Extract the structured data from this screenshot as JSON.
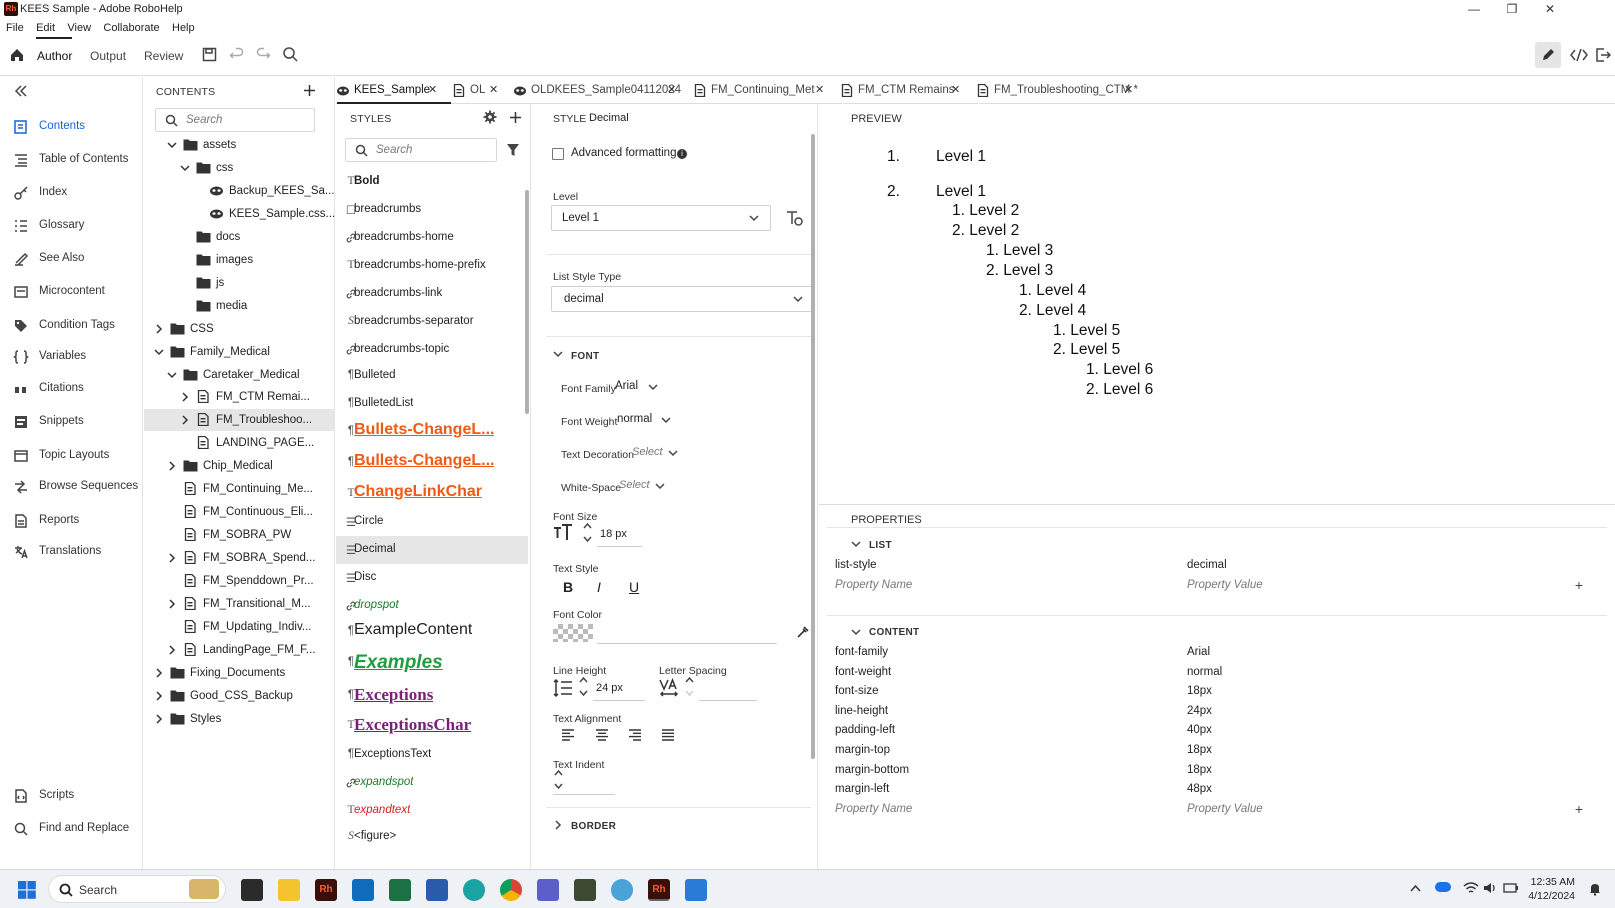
{
  "window": {
    "app_badge": "Rh",
    "title": "KEES Sample - Adobe RoboHelp",
    "minimize": "—",
    "maximize": "❐",
    "close": "✕"
  },
  "menu": [
    "File",
    "Edit",
    "View",
    "Collaborate",
    "Help"
  ],
  "toolbar": {
    "modes": [
      "Author",
      "Output",
      "Review"
    ],
    "active_mode": "Author"
  },
  "leftnav": {
    "items": [
      {
        "label": "Contents",
        "icon": "contents-icon"
      },
      {
        "label": "Table of Contents",
        "icon": "toc-icon"
      },
      {
        "label": "Index",
        "icon": "index-icon"
      },
      {
        "label": "Glossary",
        "icon": "glossary-icon"
      },
      {
        "label": "See Also",
        "icon": "see-also-icon"
      },
      {
        "label": "Microcontent",
        "icon": "microcontent-icon"
      },
      {
        "label": "Condition Tags",
        "icon": "tag-icon"
      },
      {
        "label": "Variables",
        "icon": "braces-icon"
      },
      {
        "label": "Citations",
        "icon": "quote-icon"
      },
      {
        "label": "Snippets",
        "icon": "snippet-icon"
      },
      {
        "label": "Topic Layouts",
        "icon": "layout-icon"
      },
      {
        "label": "Browse Sequences",
        "icon": "sequence-icon"
      },
      {
        "label": "Reports",
        "icon": "report-icon"
      },
      {
        "label": "Translations",
        "icon": "translate-icon"
      },
      {
        "label": "Scripts",
        "icon": "script-icon"
      },
      {
        "label": "Find and Replace",
        "icon": "find-replace-icon"
      }
    ]
  },
  "contents": {
    "title": "CONTENTS",
    "search_placeholder": "Search",
    "tree": [
      {
        "label": "assets",
        "type": "folder",
        "expanded": true
      },
      {
        "label": "css",
        "type": "folder",
        "expanded": true
      },
      {
        "label": "Backup_KEES_Sa...",
        "type": "css"
      },
      {
        "label": "KEES_Sample.css...",
        "type": "css"
      },
      {
        "label": "docs",
        "type": "folder"
      },
      {
        "label": "images",
        "type": "folder"
      },
      {
        "label": "js",
        "type": "folder"
      },
      {
        "label": "media",
        "type": "folder"
      },
      {
        "label": "CSS",
        "type": "folder",
        "collapsed": true
      },
      {
        "label": "Family_Medical",
        "type": "folder",
        "expanded": true
      },
      {
        "label": "Caretaker_Medical",
        "type": "folder",
        "expanded": true
      },
      {
        "label": "FM_CTM Remai...",
        "type": "doc",
        "collapsed": true
      },
      {
        "label": "FM_Troubleshoo...",
        "type": "doc",
        "collapsed": true,
        "selected": true
      },
      {
        "label": "LANDING_PAGE...",
        "type": "doc"
      },
      {
        "label": "Chip_Medical",
        "type": "folder",
        "collapsed": true
      },
      {
        "label": "FM_Continuing_Me...",
        "type": "doc"
      },
      {
        "label": "FM_Continuous_Eli...",
        "type": "doc"
      },
      {
        "label": "FM_SOBRA_PW",
        "type": "doc"
      },
      {
        "label": "FM_SOBRA_Spend...",
        "type": "doc",
        "collapsed": true
      },
      {
        "label": "FM_Spenddown_Pr...",
        "type": "doc"
      },
      {
        "label": "FM_Transitional_M...",
        "type": "doc",
        "collapsed": true
      },
      {
        "label": "FM_Updating_Indiv...",
        "type": "doc"
      },
      {
        "label": "LandingPage_FM_F...",
        "type": "doc",
        "collapsed": true
      },
      {
        "label": "Fixing_Documents",
        "type": "folder",
        "collapsed": true
      },
      {
        "label": "Good_CSS_Backup",
        "type": "folder",
        "collapsed": true
      },
      {
        "label": "Styles",
        "type": "folder",
        "collapsed": true
      }
    ]
  },
  "tabs": [
    {
      "label": "KEES_Sample",
      "active": true
    },
    {
      "label": "OL"
    },
    {
      "label": "OLDKEES_Sample04112024"
    },
    {
      "label": "FM_Continuing_Met"
    },
    {
      "label": "FM_CTM Remains"
    },
    {
      "label": "FM_Troubleshooting_CTM *"
    }
  ],
  "styles_panel": {
    "title": "STYLES",
    "search_placeholder": "Search",
    "items": [
      {
        "label": "Bold",
        "icon": "T"
      },
      {
        "label": "breadcrumbs",
        "icon": "☐"
      },
      {
        "label": "breadcrumbs-home",
        "icon": "link"
      },
      {
        "label": "breadcrumbs-home-prefix",
        "icon": "T"
      },
      {
        "label": "breadcrumbs-link",
        "icon": "link"
      },
      {
        "label": "breadcrumbs-separator",
        "icon": "S"
      },
      {
        "label": "breadcrumbs-topic",
        "icon": "link"
      },
      {
        "label": "Bulleted",
        "icon": "¶"
      },
      {
        "label": "BulletedList",
        "icon": "¶"
      },
      {
        "label": "Bullets-ChangeL...",
        "icon": "¶"
      },
      {
        "label": "Bullets-ChangeL...",
        "icon": "¶"
      },
      {
        "label": "ChangeLinkChar",
        "icon": "T"
      },
      {
        "label": "Circle",
        "icon": "☰"
      },
      {
        "label": "Decimal",
        "icon": "☰",
        "selected": true
      },
      {
        "label": "Disc",
        "icon": "☰"
      },
      {
        "label": "dropspot",
        "icon": "link"
      },
      {
        "label": "ExampleContent",
        "icon": "¶"
      },
      {
        "label": "Examples",
        "icon": "¶"
      },
      {
        "label": "Exceptions",
        "icon": "¶"
      },
      {
        "label": "ExceptionsChar",
        "icon": "T"
      },
      {
        "label": "ExceptionsText",
        "icon": "¶"
      },
      {
        "label": "expandspot",
        "icon": "link"
      },
      {
        "label": "expandtext",
        "icon": "T"
      },
      {
        "label": "<figure>",
        "icon": "S"
      }
    ]
  },
  "editor": {
    "header_label": "STYLE",
    "style_name": "Decimal",
    "advanced_formatting": "Advanced formatting",
    "level_label": "Level",
    "level_value": "Level 1",
    "list_style_type_label": "List Style Type",
    "list_style_type_value": "decimal",
    "font_section": "FONT",
    "font_family_label": "Font Family",
    "font_family_value": "Arial",
    "font_weight_label": "Font Weight",
    "font_weight_value": "normal",
    "text_decoration_label": "Text Decoration",
    "text_decoration_value": "Select",
    "white_space_label": "White-Space",
    "white_space_value": "Select",
    "font_size_label": "Font Size",
    "font_size_value": "18 px",
    "text_style_label": "Text Style",
    "font_color_label": "Font Color",
    "line_height_label": "Line Height",
    "line_height_value": "24 px",
    "letter_spacing_label": "Letter Spacing",
    "text_alignment_label": "Text Alignment",
    "text_indent_label": "Text Indent",
    "border_section": "BORDER",
    "bold_glyph": "B",
    "italic_glyph": "I",
    "underline_glyph": "U"
  },
  "preview": {
    "title": "PREVIEW",
    "lines": [
      {
        "marker": "1.",
        "text": "Level 1"
      },
      {
        "marker": "2.",
        "text": "Level 1"
      },
      {
        "text": "1. Level 2"
      },
      {
        "text": "2. Level 2"
      },
      {
        "text": "1. Level 3"
      },
      {
        "text": "2. Level 3"
      },
      {
        "text": "1. Level 4"
      },
      {
        "text": "2. Level 4"
      },
      {
        "text": "1. Level 5"
      },
      {
        "text": "2. Level 5"
      },
      {
        "text": "1. Level 6"
      },
      {
        "text": "2. Level 6"
      }
    ]
  },
  "properties": {
    "title": "PROPERTIES",
    "list_section": "LIST",
    "list_rows": [
      {
        "name": "list-style",
        "value": "decimal"
      }
    ],
    "content_section": "CONTENT",
    "content_rows": [
      {
        "name": "font-family",
        "value": "Arial"
      },
      {
        "name": "font-weight",
        "value": "normal"
      },
      {
        "name": "font-size",
        "value": "18px"
      },
      {
        "name": "line-height",
        "value": "24px"
      },
      {
        "name": "padding-left",
        "value": "40px"
      },
      {
        "name": "margin-top",
        "value": "18px"
      },
      {
        "name": "margin-bottom",
        "value": "18px"
      },
      {
        "name": "margin-left",
        "value": "48px"
      }
    ],
    "name_placeholder": "Property Name",
    "value_placeholder": "Property Value"
  },
  "taskbar": {
    "search_label": "Search",
    "time": "12:35 AM",
    "date": "4/12/2024"
  }
}
